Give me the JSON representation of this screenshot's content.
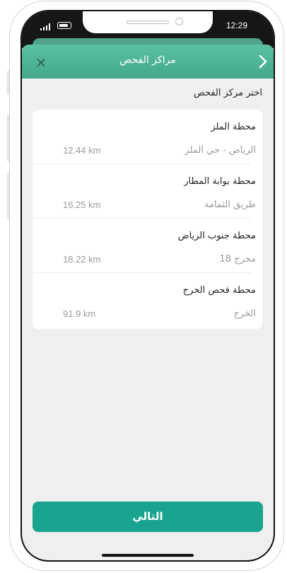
{
  "status_bar": {
    "time": "12:29"
  },
  "header": {
    "title": "مراكز الفحص",
    "close_icon": "close-icon",
    "back_icon": "chevron-right-icon"
  },
  "section_label": "اختر مركز الفحص",
  "stations": [
    {
      "name": "محطة الملز",
      "location": "الرياض - حي الملز",
      "distance": "12.44 km"
    },
    {
      "name": "محطة بوابة المطار",
      "location": "طريق الثمامة",
      "distance": "16.25 km"
    },
    {
      "name": "محطة جنوب الرياض",
      "location": "مخرج 18",
      "distance": "18.22 km"
    },
    {
      "name": "محطة فحص الخرج",
      "location": "الخرج",
      "distance": "91.9 km"
    }
  ],
  "next_button": {
    "label": "التالي"
  },
  "colors": {
    "accent": "#1aa38f",
    "header": "#4fb398"
  }
}
